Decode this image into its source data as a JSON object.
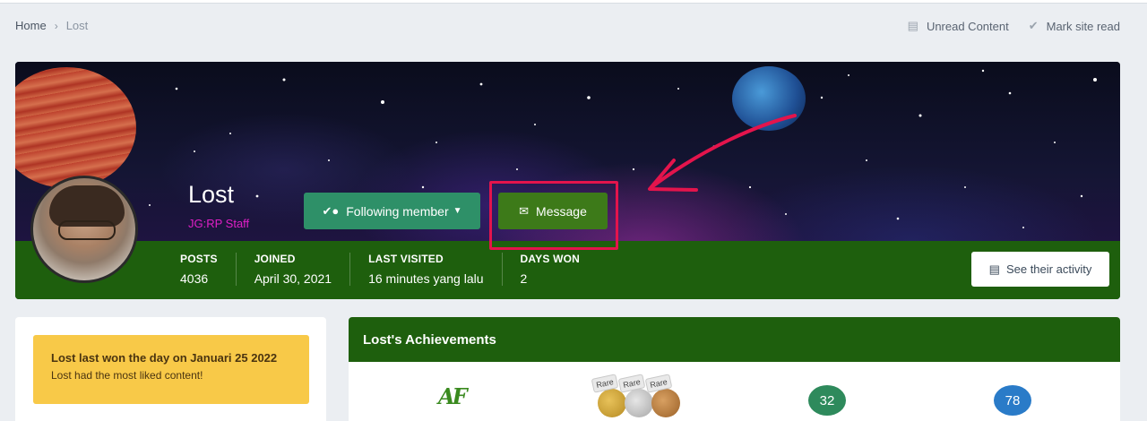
{
  "breadcrumb": {
    "home": "Home",
    "current": "Lost"
  },
  "top_actions": {
    "unread": "Unread Content",
    "mark_read": "Mark site read"
  },
  "profile": {
    "name": "Lost",
    "rank": "JG:RP Staff",
    "follow_label": "Following member",
    "message_label": "Message",
    "activity_label": "See their activity",
    "stats": [
      {
        "label": "POSTS",
        "value": "4036"
      },
      {
        "label": "JOINED",
        "value": "April 30, 2021"
      },
      {
        "label": "LAST VISITED",
        "value": "16 minutes yang lalu"
      },
      {
        "label": "DAYS WON",
        "value": "2"
      }
    ]
  },
  "day_won": {
    "title": "Lost last won the day on Januari 25 2022",
    "subtitle": "Lost had the most liked content!"
  },
  "achievements": {
    "heading": "Lost's Achievements",
    "logo_text": "AF",
    "badge_tags": [
      "Rare",
      "Rare",
      "Rare"
    ],
    "count_green": "32",
    "count_blue": "78"
  },
  "colors": {
    "brand_green": "#1e5f0d",
    "follow_button": "#2e9068",
    "message_button": "#3d7a19",
    "rank_text": "#e01fc6",
    "annotation_red": "#e4144c",
    "day_box": "#f8c948"
  },
  "icons": {
    "unread": "newspaper-icon",
    "mark_read": "check-icon",
    "follow": "check-user-icon",
    "message": "envelope-icon",
    "activity": "newspaper-icon"
  }
}
